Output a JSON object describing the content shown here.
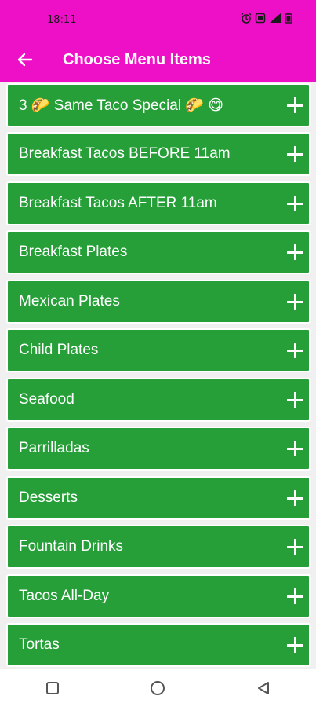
{
  "status_bar": {
    "time": "18:11",
    "icons": [
      "alarm-icon",
      "sim-card-icon",
      "signal-icon",
      "battery-icon"
    ]
  },
  "toolbar": {
    "title": "Choose Menu Items",
    "back_icon": "arrow-back-icon"
  },
  "colors": {
    "appbar": "#ee10c6",
    "item_background": "#269f38",
    "page_background": "#f0f0f0"
  },
  "menu_items": [
    {
      "label": "3 🌮 Same Taco Special 🌮 😋"
    },
    {
      "label": "Breakfast Tacos BEFORE 11am"
    },
    {
      "label": "Breakfast Tacos AFTER 11am"
    },
    {
      "label": "Breakfast Plates"
    },
    {
      "label": "Mexican Plates"
    },
    {
      "label": "Child Plates"
    },
    {
      "label": "Seafood"
    },
    {
      "label": "Parrilladas"
    },
    {
      "label": "Desserts"
    },
    {
      "label": "Fountain Drinks"
    },
    {
      "label": "Tacos All-Day"
    },
    {
      "label": "Tortas"
    }
  ],
  "nav_bar": {
    "icons": [
      "square-recents-icon",
      "circle-home-icon",
      "triangle-back-icon"
    ]
  }
}
